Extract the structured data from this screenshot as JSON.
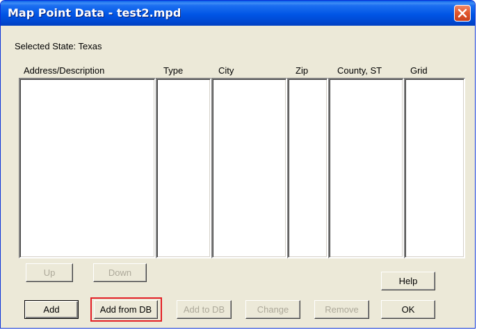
{
  "window": {
    "title": "Map Point Data - test2.mpd",
    "close_icon": "close-icon"
  },
  "selected_state": {
    "text": "Selected State:  Texas"
  },
  "columns": [
    {
      "label": "Address/Description"
    },
    {
      "label": "Type"
    },
    {
      "label": "City"
    },
    {
      "label": "Zip"
    },
    {
      "label": "County, ST"
    },
    {
      "label": "Grid"
    }
  ],
  "buttons": {
    "up": "Up",
    "down": "Down",
    "help": "Help",
    "add": "Add",
    "add_from_db": "Add from DB",
    "add_to_db": "Add to DB",
    "change": "Change",
    "remove": "Remove",
    "ok": "OK"
  },
  "colors": {
    "titlebar": "#0055e5",
    "dialog_bg": "#ece9d8",
    "highlight": "#e31e24",
    "close_button": "#e2582e"
  }
}
